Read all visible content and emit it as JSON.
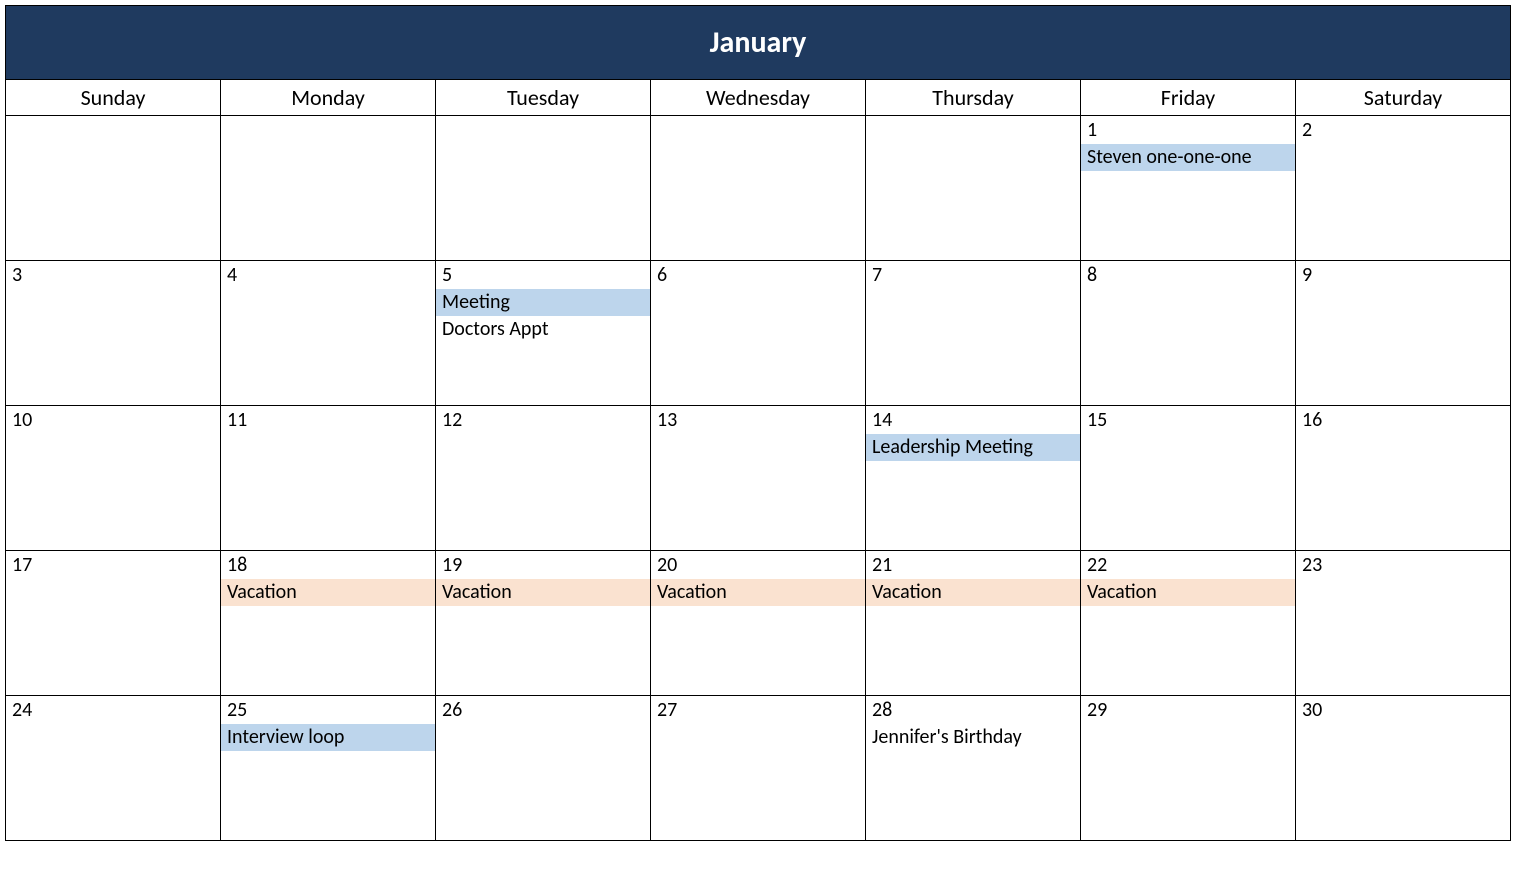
{
  "month_title": "January",
  "day_headers": [
    "Sunday",
    "Monday",
    "Tuesday",
    "Wednesday",
    "Thursday",
    "Friday",
    "Saturday"
  ],
  "colors": {
    "header_bg": "#1f3a5f",
    "event_blue": "#bdd5ec",
    "event_peach": "#fae2d0"
  },
  "weeks": [
    [
      {
        "date": "",
        "events": []
      },
      {
        "date": "",
        "events": []
      },
      {
        "date": "",
        "events": []
      },
      {
        "date": "",
        "events": []
      },
      {
        "date": "",
        "events": []
      },
      {
        "date": "1",
        "events": [
          {
            "label": "Steven one-one-one",
            "color": "blue"
          }
        ]
      },
      {
        "date": "2",
        "events": []
      }
    ],
    [
      {
        "date": "3",
        "events": []
      },
      {
        "date": "4",
        "events": []
      },
      {
        "date": "5",
        "events": [
          {
            "label": "Meeting",
            "color": "blue"
          },
          {
            "label": "Doctors Appt",
            "color": "none"
          }
        ]
      },
      {
        "date": "6",
        "events": []
      },
      {
        "date": "7",
        "events": []
      },
      {
        "date": "8",
        "events": []
      },
      {
        "date": "9",
        "events": []
      }
    ],
    [
      {
        "date": "10",
        "events": []
      },
      {
        "date": "11",
        "events": []
      },
      {
        "date": "12",
        "events": []
      },
      {
        "date": "13",
        "events": []
      },
      {
        "date": "14",
        "events": [
          {
            "label": "Leadership Meeting",
            "color": "blue"
          }
        ]
      },
      {
        "date": "15",
        "events": []
      },
      {
        "date": "16",
        "events": []
      }
    ],
    [
      {
        "date": "17",
        "events": []
      },
      {
        "date": "18",
        "events": [
          {
            "label": "Vacation",
            "color": "peach"
          }
        ]
      },
      {
        "date": "19",
        "events": [
          {
            "label": "Vacation",
            "color": "peach"
          }
        ]
      },
      {
        "date": "20",
        "events": [
          {
            "label": "Vacation",
            "color": "peach"
          }
        ]
      },
      {
        "date": "21",
        "events": [
          {
            "label": "Vacation",
            "color": "peach"
          }
        ]
      },
      {
        "date": "22",
        "events": [
          {
            "label": "Vacation",
            "color": "peach"
          }
        ]
      },
      {
        "date": "23",
        "events": []
      }
    ],
    [
      {
        "date": "24",
        "events": []
      },
      {
        "date": "25",
        "events": [
          {
            "label": "Interview loop",
            "color": "blue"
          }
        ]
      },
      {
        "date": "26",
        "events": []
      },
      {
        "date": "27",
        "events": []
      },
      {
        "date": "28",
        "events": [
          {
            "label": "Jennifer's Birthday",
            "color": "none"
          }
        ]
      },
      {
        "date": "29",
        "events": []
      },
      {
        "date": "30",
        "events": []
      }
    ]
  ]
}
